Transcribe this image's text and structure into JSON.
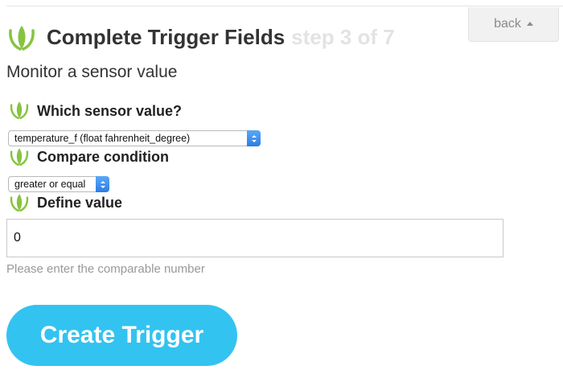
{
  "header": {
    "back_label": "back",
    "title": "Complete Trigger Fields",
    "step": "step 3 of 7"
  },
  "subtitle": "Monitor a sensor value",
  "fields": {
    "sensor": {
      "label": "Which sensor value?",
      "selected": "temperature_f (float fahrenheit_degree)"
    },
    "condition": {
      "label": "Compare condition",
      "selected": "greater or equal"
    },
    "value": {
      "label": "Define value",
      "input_value": "0",
      "helper": "Please enter the comparable number"
    }
  },
  "submit_label": "Create Trigger",
  "colors": {
    "accent": "#33c3f0",
    "leaf_green": "#86c440",
    "step_text": "#e3e3e3",
    "select_arrow": "#2b7ee8"
  },
  "icons": [
    "leaf-logo-icon",
    "caret-up-icon",
    "select-chevrons-icon"
  ]
}
